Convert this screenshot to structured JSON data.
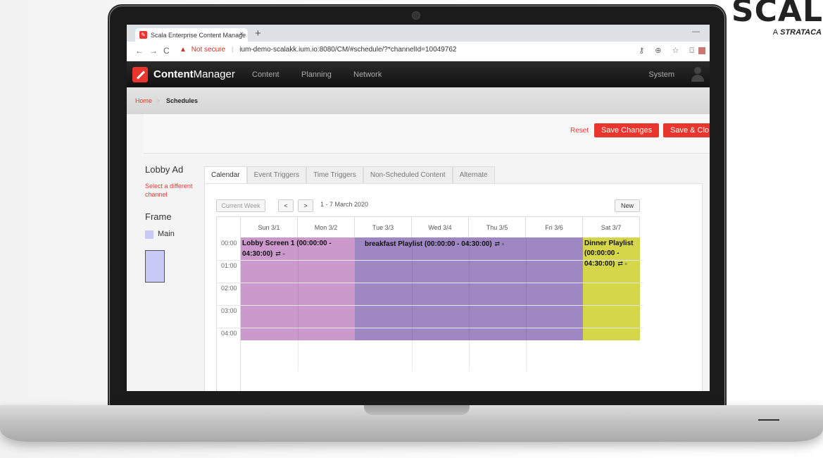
{
  "brand": {
    "name": "SCAL",
    "sub_prefix": "A",
    "sub_name": "STRATACA"
  },
  "browser": {
    "tab_title": "Scala Enterprise Content Manage",
    "tab_close": "×",
    "new_tab": "+",
    "minimize": "—",
    "warning_icon": "▲",
    "not_secure": "Not secure",
    "separator": "|",
    "url": "ium-demo-scalakk.ium.io:8080/CM/#schedule/?*channelId=10049762",
    "back": "←",
    "forward": "→",
    "reload": "C",
    "toolbar_icons": "⚷ ⊕ ☆ ⌼"
  },
  "app": {
    "name_bold": "Content",
    "name_thin": "Manager",
    "nav": [
      "Content",
      "Planning",
      "Network"
    ],
    "system": "System"
  },
  "breadcrumb": {
    "home": "Home",
    "sep": ">",
    "current": "Schedules"
  },
  "actions": {
    "reset": "Reset",
    "save_changes": "Save Changes",
    "save_close": "Save & Clo"
  },
  "sidebar": {
    "channel": "Lobby Ad",
    "select_link": "Select a different channel",
    "frame_title": "Frame",
    "frame_main": "Main"
  },
  "tabs": [
    "Calendar",
    "Event Triggers",
    "Time Triggers",
    "Non-Scheduled Content",
    "Alternate"
  ],
  "calendar": {
    "current_week": "Current Week",
    "prev": "<",
    "next": ">",
    "range": "1 - 7 March 2020",
    "new": "New",
    "days": [
      "Sun 3/1",
      "Mon 3/2",
      "Tue 3/3",
      "Wed 3/4",
      "Thu 3/5",
      "Fri 3/6",
      "Sat 3/7"
    ],
    "hours": [
      "00:00",
      "01:00",
      "02:00",
      "03:00",
      "04:00"
    ],
    "events": [
      {
        "label": "Lobby Screen 1 (00:00:00 - 04:30:00)",
        "color": "#cc99cc"
      },
      {
        "label": "breakfast Playlist (00:00:00 - 04:30:00)",
        "color": "#9f87c4"
      },
      {
        "label": "Dinner Playlist (00:00:00 - 04:30:00)",
        "color": "#d6d64a"
      }
    ],
    "event_icons": "⇄ ▫"
  },
  "colors": {
    "accent": "#e8362f",
    "frame_main": "#c9c9f5"
  }
}
